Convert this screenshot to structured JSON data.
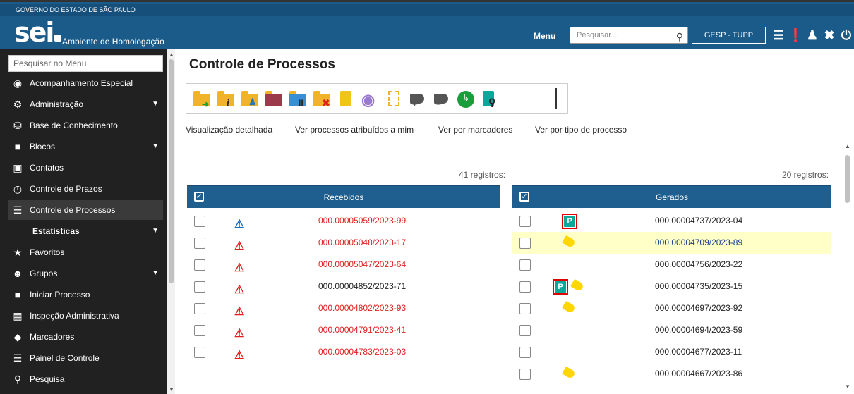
{
  "header": {
    "government": "GOVERNO DO ESTADO DE SÃO PAULO",
    "logo": "sei",
    "environment": "Ambiente de Homologação",
    "menu_label": "Menu",
    "search_placeholder": "Pesquisar...",
    "unit": "GESP - TUPP",
    "icons": [
      "list-icon",
      "alert-icon",
      "user-icon",
      "tools-icon",
      "power-icon"
    ],
    "bar_color": "#1a5b8a"
  },
  "sidebar": {
    "search_placeholder": "Pesquisar no Menu",
    "items": [
      {
        "label": "Acompanhamento Especial",
        "icon": "eye-icon"
      },
      {
        "label": "Administração",
        "icon": "gears-icon",
        "expandable": true
      },
      {
        "label": "Base de Conhecimento",
        "icon": "database-icon"
      },
      {
        "label": "Blocos",
        "icon": "folder-icon",
        "expandable": true
      },
      {
        "label": "Contatos",
        "icon": "contact-card-icon"
      },
      {
        "label": "Controle de Prazos",
        "icon": "clock-icon"
      },
      {
        "label": "Controle de Processos",
        "icon": "list-icon",
        "active": true
      },
      {
        "label": "Estatísticas",
        "icon": "",
        "expandable": true
      },
      {
        "label": "Favoritos",
        "icon": "star-icon"
      },
      {
        "label": "Grupos",
        "icon": "group-icon",
        "expandable": true
      },
      {
        "label": "Iniciar Processo",
        "icon": "folder-icon"
      },
      {
        "label": "Inspeção Administrativa",
        "icon": "inspect-icon"
      },
      {
        "label": "Marcadores",
        "icon": "tag-icon"
      },
      {
        "label": "Painel de Controle",
        "icon": "panel-icon"
      },
      {
        "label": "Pesquisa",
        "icon": "search-icon"
      }
    ]
  },
  "main": {
    "title": "Controle de Processos",
    "toolbar_icons": [
      "new-process-icon",
      "process-info-icon",
      "assign-user-icon",
      "add-to-block-icon",
      "suspend-icon",
      "close-process-icon",
      "note-icon",
      "view-icon",
      "new-document-icon",
      "add-tag-icon",
      "remove-tag-icon",
      "deadline-icon",
      "search-process-icon"
    ],
    "view_links": [
      "Visualização detalhada",
      "Ver processos atribuídos a mim",
      "Ver por marcadores",
      "Ver por tipo de processo"
    ],
    "received": {
      "count": "41 registros:",
      "title": "Recebidos",
      "rows": [
        {
          "number": "000.00005059/2023-99",
          "alert": "blue",
          "unread": true
        },
        {
          "number": "000.00005048/2023-17",
          "alert": "red",
          "unread": true
        },
        {
          "number": "000.00005047/2023-64",
          "alert": "red",
          "unread": true
        },
        {
          "number": "000.00004852/2023-71",
          "alert": "red",
          "unread": false
        },
        {
          "number": "000.00004802/2023-93",
          "alert": "red",
          "unread": true
        },
        {
          "number": "000.00004791/2023-41",
          "alert": "red",
          "unread": true
        },
        {
          "number": "000.00004783/2023-03",
          "alert": "red",
          "unread": true
        }
      ]
    },
    "generated": {
      "count": "20 registros:",
      "title": "Gerados",
      "rows": [
        {
          "number": "000.00004737/2023-04",
          "pdoc": true,
          "tag": false,
          "highlight": false
        },
        {
          "number": "000.00004709/2023-89",
          "pdoc": false,
          "tag": true,
          "highlight": true
        },
        {
          "number": "000.00004756/2023-22",
          "pdoc": false,
          "tag": false,
          "highlight": false
        },
        {
          "number": "000.00004735/2023-15",
          "pdoc": true,
          "tag": true,
          "highlight": false
        },
        {
          "number": "000.00004697/2023-92",
          "pdoc": false,
          "tag": true,
          "highlight": false
        },
        {
          "number": "000.00004694/2023-59",
          "pdoc": false,
          "tag": false,
          "highlight": false
        },
        {
          "number": "000.00004677/2023-11",
          "pdoc": false,
          "tag": false,
          "highlight": false
        },
        {
          "number": "000.00004667/2023-86",
          "pdoc": false,
          "tag": true,
          "highlight": false
        }
      ]
    },
    "colors": {
      "unread": "#e02020",
      "link": "#1b3f8f",
      "header": "#1e5f8f",
      "tag": "#ffd700",
      "pdoc": "#0aa79a"
    }
  }
}
